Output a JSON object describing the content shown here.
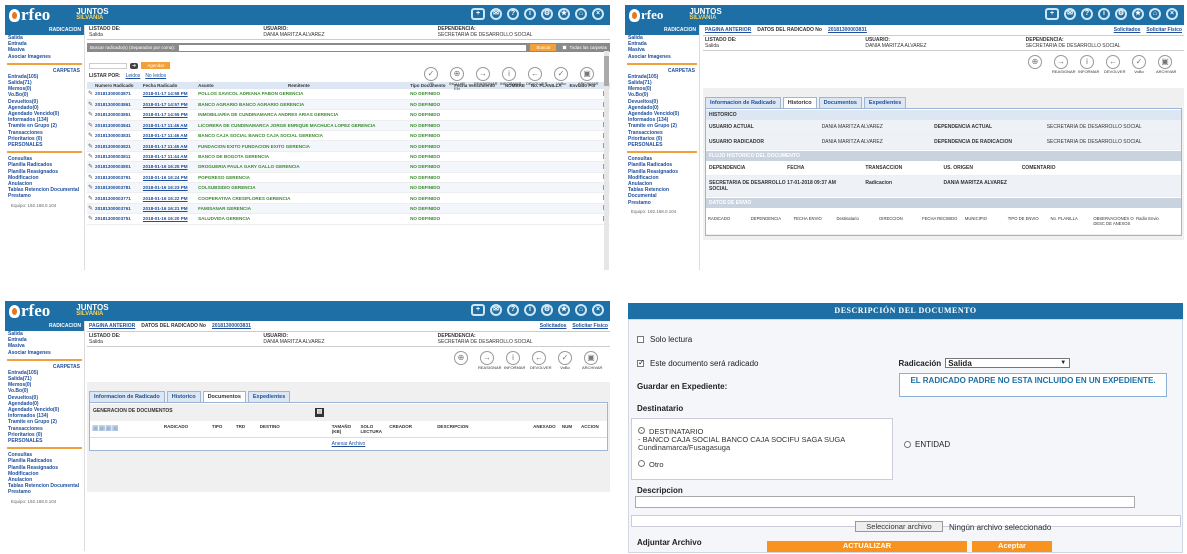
{
  "common": {
    "logo": "rfeo",
    "brand_top": "JUNTOS",
    "brand_bottom": "SILVANIA",
    "header_icons": [
      "rad",
      "1",
      "2",
      "3",
      "4",
      "5",
      "6",
      "7"
    ],
    "sidebar_head": "RADICACION",
    "sidebar_items": [
      "Salida",
      "Entrada",
      "Masiva",
      "Asociar Imagenes"
    ],
    "carpetas_label": "CARPETAS",
    "carpetas": [
      "Entrada(105)",
      "Salida(71)",
      "Memos(0)",
      "Vo.Bo(0)",
      "Devueltos(0)",
      "Agendado(0)",
      "Agendado Vencido(0)",
      "Informados (134)",
      "Tramite en Grupo (2)",
      "Transacciones"
    ],
    "personales": [
      "Prioritarios (0)",
      "PERSONALES"
    ],
    "consultas": [
      "Consultas",
      "Planilla Radicados",
      "Planilla Reasignados",
      "Modificacion",
      "Anulacion",
      "Tablas Retencion Documental",
      "Prestamo"
    ],
    "ip": "Equipo: 192.168.0.104",
    "listado_label": "LISTADO DE:",
    "listado_value": "Salida",
    "usuario_label": "USUARIO:",
    "usuario_value": "DANIA MARITZA ALVAREZ",
    "dependencia_label": "DEPENDENCIA:",
    "dependencia_value": "SECRETARIA DE DESARROLLO SOCIAL"
  },
  "panel1": {
    "search_label": "Buscar radicado(s) (Separados por coma):",
    "search_button": "Buscar",
    "all_folders": "Todas las carpetas",
    "listar_label": "LISTAR POR:",
    "leidos": "Leidos",
    "no_leidos": "No leidos",
    "action_button": "Agendar",
    "actions": [
      "VB",
      "INCLUIR EN",
      "REASIGNAR",
      "INFORMAR",
      "DEVOLVER",
      "VoBo",
      "ARCHIVAR"
    ],
    "columns": [
      "Numero Radicado",
      "Fecha Radicado",
      "Asunto",
      "Remitente",
      "Tipo Documento",
      "Fecha Vencimiento",
      "NOMBRE",
      "No. PLANILLA",
      "Enviado Por"
    ],
    "rows": [
      {
        "rad": "20181300003871",
        "fecha": "2018-01-17 14:58 PM",
        "asunto": "POLLOS SAVICOL ADRIANA PABON GERENCIA",
        "tipo": "NO DEFINIDO"
      },
      {
        "rad": "20181300003861",
        "fecha": "2018-01-17 14:57 PM",
        "asunto": "BANCO AGRARIO BANCO AGRARIO GERENCIA",
        "tipo": "NO DEFINIDO"
      },
      {
        "rad": "20181300003851",
        "fecha": "2018-01-17 14:55 PM",
        "asunto": "INMOBILIARIA DE CUNDINAMARCA ANDRES ARIAS GERENCIA",
        "tipo": "NO DEFINIDO"
      },
      {
        "rad": "20181300003841",
        "fecha": "2018-01-17 11:46 AM",
        "asunto": "LICORERA DE CUNDINAMARCA JORGE ENRIQUE MACHUCA LOPEZ GERENCIA",
        "tipo": "NO DEFINIDO"
      },
      {
        "rad": "20181300003831",
        "fecha": "2018-01-17 11:46 AM",
        "asunto": "BANCO CAJA SOCIAL BANCO CAJA SOCIAL GERENCIA",
        "tipo": "NO DEFINIDO"
      },
      {
        "rad": "20181300003821",
        "fecha": "2018-01-17 11:45 AM",
        "asunto": "FUNDACION EXITO FUNDACION EXITO GERENCIA",
        "tipo": "NO DEFINIDO"
      },
      {
        "rad": "20181300003811",
        "fecha": "2018-01-17 11:44 AM",
        "asunto": "BANCO DE BOGOTA GERENCIA",
        "tipo": "NO DEFINIDO"
      },
      {
        "rad": "20181300003801",
        "fecha": "2018-01-16 16:25 PM",
        "asunto": "DROGUERIA PAULA GARY GALLO GERENCIA",
        "tipo": "NO DEFINIDO"
      },
      {
        "rad": "20181300003791",
        "fecha": "2018-01-16 16:24 PM",
        "asunto": "POPGRESO GERENCIA",
        "tipo": "NO DEFINIDO"
      },
      {
        "rad": "20181300003781",
        "fecha": "2018-01-16 16:23 PM",
        "asunto": "COLSUBSIDIO GERENCIA",
        "tipo": "NO DEFINIDO"
      },
      {
        "rad": "20181300003771",
        "fecha": "2018-01-16 16:22 PM",
        "asunto": "COOPERATIVA CRESIFLORES GERENCIA",
        "tipo": "NO DEFINIDO"
      },
      {
        "rad": "20181300003761",
        "fecha": "2018-01-16 16:21 PM",
        "asunto": "FAMISANAR GERENCIA",
        "tipo": "NO DEFINIDO"
      },
      {
        "rad": "20181300003751",
        "fecha": "2018-01-16 16:20 PM",
        "asunto": "SALUDVIDA GERENCIA",
        "tipo": "NO DEFINIDO"
      }
    ]
  },
  "panel2": {
    "pagina_anterior": "PAGINA ANTERIOR",
    "datos_label": "DATOS DEL RADICADO No",
    "radicado_no": "20181300003831",
    "solicitados": "Solicitados",
    "solicitar_fisico": "Solicitar Fisico",
    "tabs": [
      "Informacion de Radicado",
      "Historico",
      "Documentos",
      "Expedientes"
    ],
    "historico_label": "HISTORICO",
    "usuario_actual": "USUARIO ACTUAL",
    "usuario_actual_v": "DANIA MARITZA ALVAREZ",
    "dep_actual": "DEPENDENCIA ACTUAL",
    "dep_actual_v": "SECRETARIA DE DESARROLLO SOCIAL",
    "usuario_rad": "USUARIO RADICADOR",
    "usuario_rad_v": "DANIA MARITZA ALVAREZ",
    "dep_rad": "DEPENDENCIA DE RADICACION",
    "dep_rad_v": "SECRETARIA DE DESARROLLO SOCIAL",
    "flujo": "FLUJO HISTORICO DEL DOCUMENTO",
    "hist_cols": [
      "DEPENDENCIA",
      "FECHA",
      "TRANSACCION",
      "US. ORIGEN",
      "COMENTARIO"
    ],
    "hist_row": [
      "SECRETARIA DE DESARROLLO SOCIAL",
      "17-01-2018 09:37 AM",
      "Radicacion",
      "DANIA MARITZA ALVAREZ",
      ""
    ],
    "envio": "DATOS DE ENVIO",
    "envio_cols": [
      "RADICADO",
      "DEPENDENCIA",
      "FECHA ENVIO",
      "Destinatario",
      "DIRECCION",
      "FECHA RECIBIDO",
      "MUNICIPIO",
      "TIPO DE ENVIO",
      "No. PLANILLA",
      "OBSERVACIONES O DESC DE ANEXOS",
      "Radio Envio"
    ]
  },
  "panel3": {
    "radicado_no": "20181300003831",
    "generacion": "GENERACION DE DOCUMENTOS",
    "doc_cols": [
      "RADICADO",
      "TIPO",
      "TRD",
      "DESTINO",
      "TAMAÑO (KB)",
      "SOLO LECTURA",
      "CREADOR",
      "DESCRIPCION",
      "ANEXADO",
      "NUM",
      "ACCION"
    ],
    "anexar": "Anexar Archivo"
  },
  "panel4": {
    "title": "DESCRIPCIÓN DEL DOCUMENTO",
    "solo_lectura": "Solo lectura",
    "sera_radicado": "Este documento será radicado",
    "radicacion_label": "Radicación",
    "radicacion_value": "Salida",
    "guardar_exp": "Guardar en Expediente:",
    "padre_msg": "EL RADICADO PADRE NO ESTA INCLUIDO EN UN EXPEDIENTE.",
    "destinatario": "Destinatario",
    "dest_label": "DESTINATARIO",
    "dest_value": "- BANCO CAJA SOCIAL BANCO CAJA SOCIFU SAGA SUGA Cundinamarca/Fusagasuga",
    "entidad": "ENTIDAD",
    "otro": "Otro",
    "descripcion": "Descripcion",
    "adjuntar": "Adjuntar Archivo",
    "select_file": "Seleccionar archivo",
    "no_file": "Ningún archivo seleccionado",
    "actualizar": "ACTUALIZAR",
    "aceptar": "Aceptar"
  }
}
